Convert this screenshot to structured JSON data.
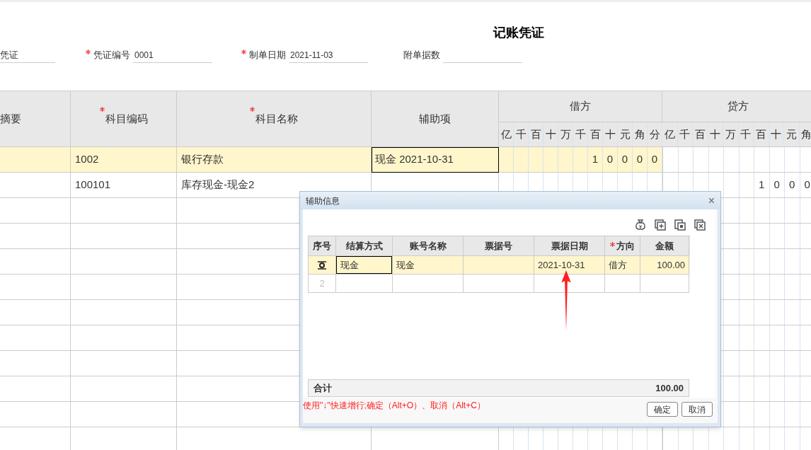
{
  "voucher": {
    "title": "记账凭证",
    "fields": [
      {
        "value": "凭证",
        "required": false
      },
      {
        "label": "凭证编号",
        "value": "0001",
        "required": true
      },
      {
        "label": "制单日期",
        "value": "2021-11-03",
        "required": true
      },
      {
        "label": "附单据数",
        "required": false
      }
    ]
  },
  "table": {
    "columns": [
      {
        "label": "摘要",
        "required": false
      },
      {
        "label": "科目编码",
        "required": true
      },
      {
        "label": "科目名称",
        "required": true
      },
      {
        "label": "辅助项",
        "required": false
      }
    ],
    "debit": {
      "label": "借方",
      "units": [
        "亿",
        "千",
        "百",
        "十",
        "万",
        "千",
        "百",
        "十",
        "元",
        "角",
        "分"
      ]
    },
    "credit": {
      "label": "贷方",
      "units": [
        "亿",
        "千",
        "百",
        "十",
        "万",
        "千",
        "百",
        "十",
        "元",
        "角"
      ]
    },
    "rows": [
      {
        "code": "1002",
        "name": "银行存款",
        "aux": "现金 2021-10-31",
        "debit": [
          "1",
          "0",
          "0",
          "0",
          "0"
        ],
        "selected": true
      },
      {
        "code": "100101",
        "name": "库存现金-现金2",
        "credit": [
          "1",
          "0",
          "0",
          "0"
        ],
        "selected": false
      }
    ]
  },
  "dialog": {
    "title": "辅助信息",
    "close": "×",
    "columns": [
      {
        "label": "序号",
        "required": false
      },
      {
        "label": "结算方式",
        "required": false
      },
      {
        "label": "账号名称",
        "required": false
      },
      {
        "label": "票据号",
        "required": false
      },
      {
        "label": "票据日期",
        "required": false
      },
      {
        "label": "方向",
        "required": true
      },
      {
        "label": "金额",
        "required": false
      }
    ],
    "rows": [
      {
        "settlement": "现金",
        "account": "现金",
        "bill_date": "2021-10-31",
        "direction": "借方",
        "amount": "100.00",
        "selected": true
      },
      {
        "seq": "2",
        "selected": false
      }
    ],
    "total_label": "合计",
    "total": "100.00",
    "hint": "使用\"↓\"快速增行;确定（Alt+O）、取消（Alt+C）",
    "buttons": [
      "确定",
      "取消"
    ]
  }
}
